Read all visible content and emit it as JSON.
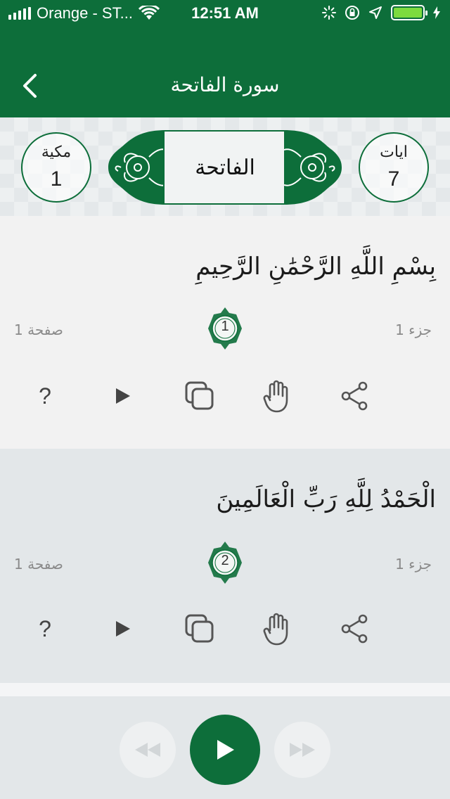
{
  "status_bar": {
    "carrier": "Orange - ST...",
    "time": "12:51 AM"
  },
  "nav": {
    "title": "سورة الفاتحة",
    "back_icon": "chevron-left-icon"
  },
  "surah_header": {
    "name": "الفاتحة",
    "type_label": "مكية",
    "type_number": "1",
    "ayat_label": "ايات",
    "ayat_count": "7"
  },
  "ayahs": [
    {
      "text": "بِسْمِ اللَّهِ الرَّحْمَٰنِ الرَّحِيمِ",
      "number": "1",
      "page": "صفحة 1",
      "juz": "جزء 1"
    },
    {
      "text": "الْحَمْدُ لِلَّهِ رَبِّ الْعَالَمِينَ",
      "number": "2",
      "page": "صفحة 1",
      "juz": "جزء 1"
    }
  ],
  "action_icons": [
    "question-icon",
    "play-icon",
    "copy-icon",
    "hand-icon",
    "share-icon"
  ],
  "actions": {
    "question_glyph": "?"
  },
  "player": {
    "buttons": [
      "rewind-icon",
      "play-icon",
      "fast-forward-icon"
    ]
  },
  "colors": {
    "brand_green": "#0d6e3a",
    "battery_green": "#7ddb3e",
    "card_light": "#f2f2f2",
    "card_dark": "#e3e7e9"
  }
}
